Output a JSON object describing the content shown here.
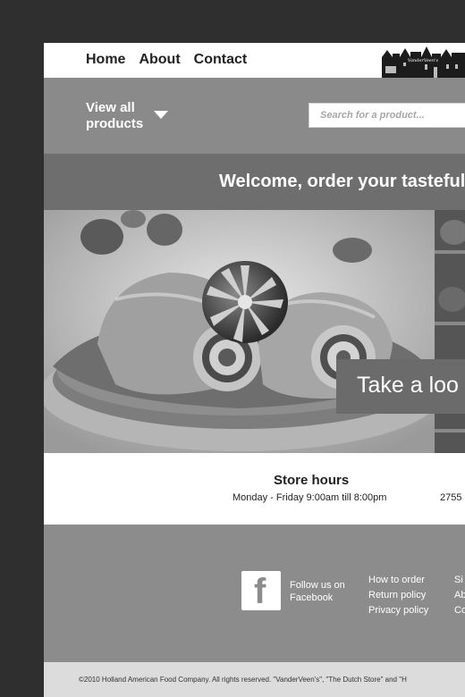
{
  "nav": {
    "home": "Home",
    "about": "About",
    "contact": "Contact",
    "logo_text": "VanderVeen's"
  },
  "filter": {
    "view_all_line1": "View all",
    "view_all_line2": "products",
    "search_placeholder": "Search for a product..."
  },
  "welcome": {
    "title": "Welcome, order your tasteful"
  },
  "hero": {
    "cta": "Take a loo"
  },
  "store": {
    "title": "Store hours",
    "hours": "Monday - Friday 9:00am till 8:00pm",
    "address": "2755"
  },
  "footer": {
    "facebook_icon": "facebook-icon",
    "follow_line1": "Follow us on",
    "follow_line2": "Facebook",
    "links": [
      "How to order",
      "Return policy",
      "Privacy policy"
    ],
    "links2": [
      "Si",
      "Ab",
      "Co"
    ]
  },
  "copyright": "©2010 Holland American Food Company. All rights reserved. \"VanderVeen's\", \"The Dutch Store\" and \"H"
}
